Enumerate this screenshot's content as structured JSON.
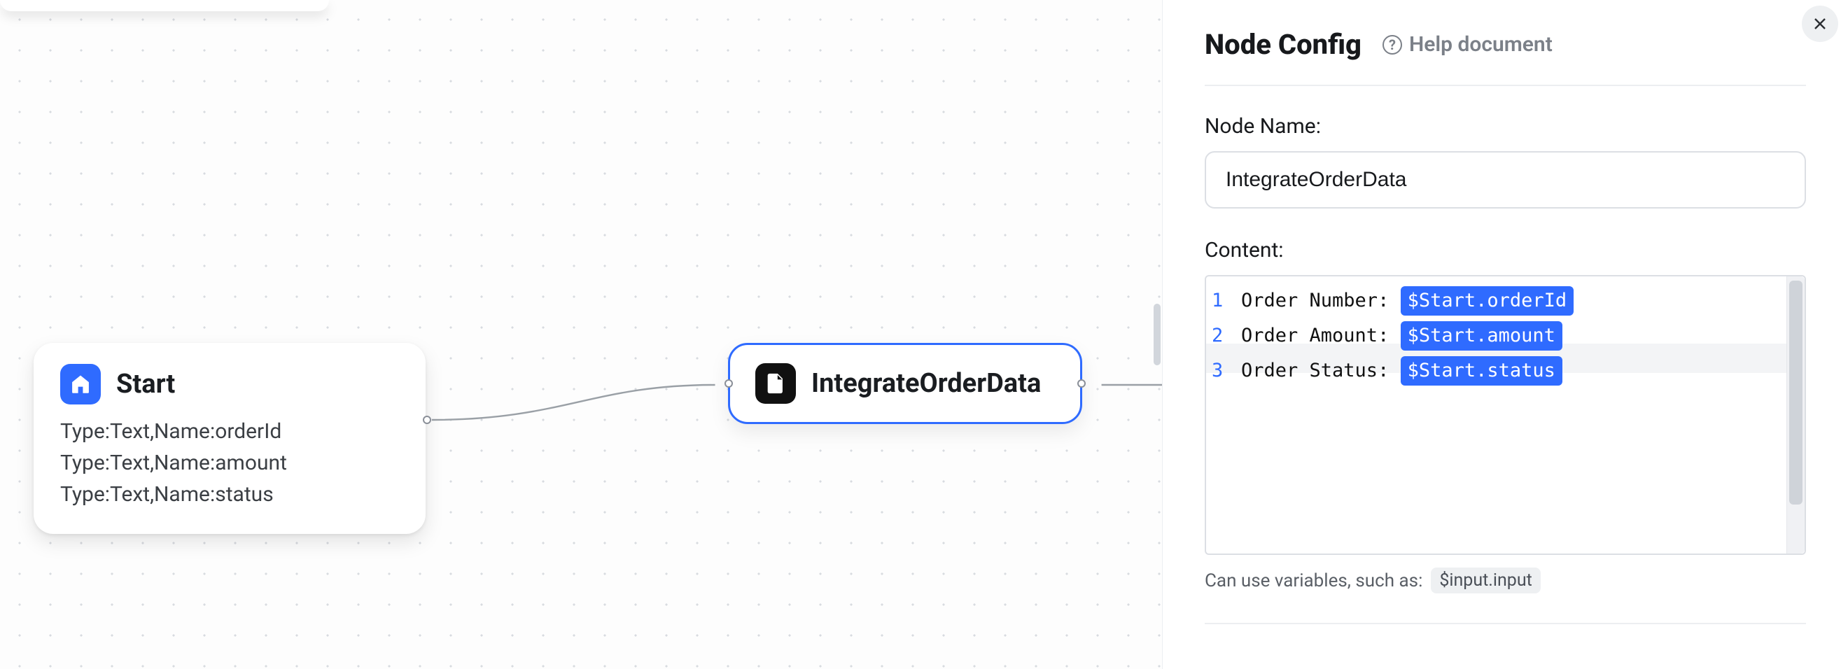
{
  "canvas": {
    "nodes": {
      "start": {
        "title": "Start",
        "params": [
          "Type:Text,Name:orderId",
          "Type:Text,Name:amount",
          "Type:Text,Name:status"
        ]
      },
      "integrate": {
        "title": "IntegrateOrderData"
      }
    }
  },
  "panel": {
    "title": "Node Config",
    "help_label": "Help document",
    "node_name": {
      "label": "Node Name:",
      "value": "IntegrateOrderData"
    },
    "content": {
      "label": "Content:",
      "lines": [
        {
          "n": "1",
          "text": "Order Number: ",
          "var": "$Start.orderId"
        },
        {
          "n": "2",
          "text": "Order Amount: ",
          "var": "$Start.amount"
        },
        {
          "n": "3",
          "text": "Order Status: ",
          "var": "$Start.status"
        }
      ]
    },
    "hint": {
      "text": "Can use variables, such as:",
      "example": "$input.input"
    }
  }
}
